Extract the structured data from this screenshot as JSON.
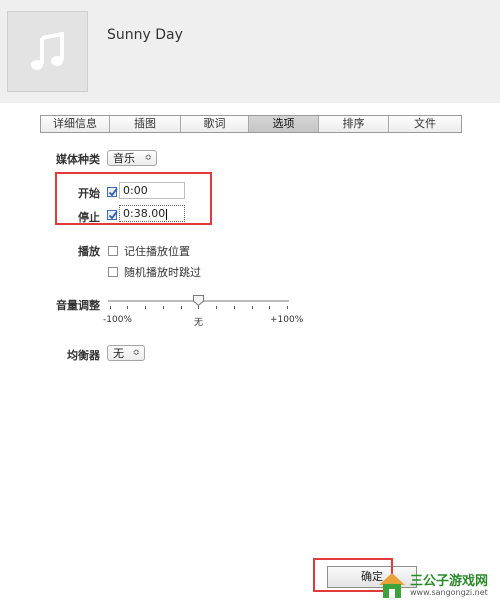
{
  "song": {
    "title": "Sunny Day",
    "artwork_icon": "music-note-icon"
  },
  "tabs": [
    {
      "label": "详细信息",
      "active": false
    },
    {
      "label": "插图",
      "active": false
    },
    {
      "label": "歌词",
      "active": false
    },
    {
      "label": "选项",
      "active": true
    },
    {
      "label": "排序",
      "active": false
    },
    {
      "label": "文件",
      "active": false
    }
  ],
  "options": {
    "media_kind": {
      "label": "媒体种类",
      "value": "音乐"
    },
    "start": {
      "label": "开始",
      "checked": true,
      "value": "0:00"
    },
    "stop": {
      "label": "停止",
      "checked": true,
      "value": "0:38.00"
    },
    "playback": {
      "label": "播放",
      "remember_position": {
        "label": "记住播放位置",
        "checked": false
      },
      "skip_shuffle": {
        "label": "随机播放时跳过",
        "checked": false
      }
    },
    "volume": {
      "label": "音量调整",
      "min_label": "-100%",
      "mid_label": "无",
      "max_label": "+100%",
      "value_percent": 0
    },
    "equalizer": {
      "label": "均衡器",
      "value": "无"
    }
  },
  "footer": {
    "ok_label": "确定"
  },
  "watermark": {
    "name": "三公子游戏网",
    "url": "www.sangongzi.net"
  },
  "colors": {
    "highlight": "#e23a3a",
    "check": "#3a6db4",
    "watermark": "#2a8a2a"
  }
}
